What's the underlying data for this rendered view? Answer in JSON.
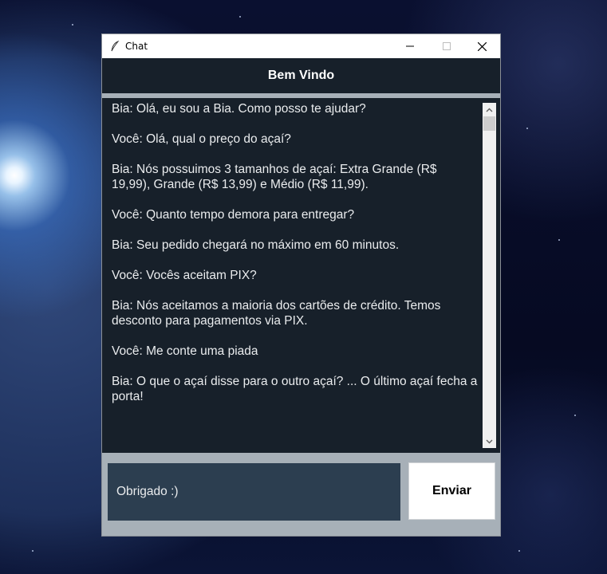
{
  "window": {
    "title": "Chat",
    "icon": "feather-icon",
    "controls": [
      "minimize-icon",
      "maximize-icon",
      "close-icon"
    ]
  },
  "header": {
    "title": "Bem Vindo"
  },
  "chat": {
    "messages": [
      "Bia: Olá, eu sou a Bia. Como posso te ajudar?",
      "Você: Olá, qual o preço do açaí?",
      "Bia: Nós possuimos 3 tamanhos de açaí: Extra Grande (R$ 19,99), Grande (R$ 13,99) e Médio (R$ 11,99).",
      "Você: Quanto tempo demora para entregar?",
      "Bia: Seu pedido chegará no máximo em 60 minutos.",
      "Você: Vocês aceitam PIX?",
      "Bia: Nós aceitamos a maioria dos cartões de crédito. Temos desconto para pagamentos via PIX.",
      "Você: Me conte uma piada",
      "Bia: O que o açaí disse para o outro açaí? ... O último açaí fecha a porta!"
    ]
  },
  "input": {
    "value": "Obrigado :)"
  },
  "send_button": {
    "label": "Enviar"
  },
  "colors": {
    "header_bg": "#17202a",
    "chat_bg": "#17202a",
    "input_bg": "#2c3e50",
    "frame_bg": "#a7b0b8",
    "text": "#eaecee"
  }
}
